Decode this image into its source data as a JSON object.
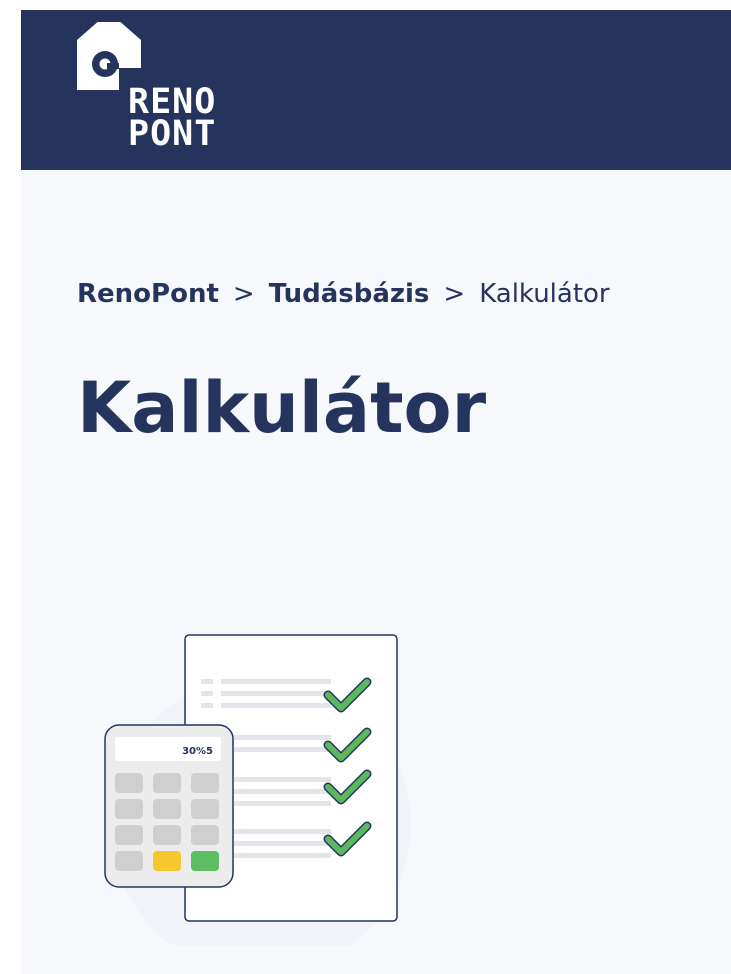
{
  "header": {
    "logo": {
      "line1": "RENO",
      "line2": "PONT"
    }
  },
  "breadcrumb": {
    "items": [
      {
        "label": "RenoPont"
      },
      {
        "label": "Tudásbázis"
      }
    ],
    "separator": ">",
    "current": "Kalkulátor"
  },
  "page": {
    "title": "Kalkulátor"
  },
  "illustration": {
    "calculator_display": "30%5"
  },
  "colors": {
    "navy": "#24345d",
    "background": "#f7f8fc",
    "check_green": "#5cb85c",
    "key_yellow": "#f7c72e",
    "key_green": "#5cbd62"
  }
}
